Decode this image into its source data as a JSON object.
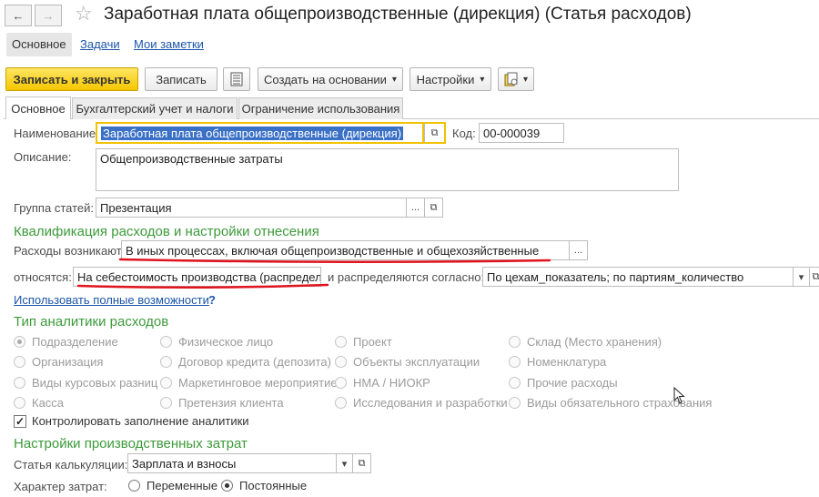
{
  "window": {
    "title": "Заработная плата общепроизводственные (дирекция) (Статья расходов)",
    "back_icon": "←",
    "forward_icon": "→",
    "star_icon": "☆"
  },
  "section_tabs": [
    "Основное",
    "Задачи",
    "Мои заметки"
  ],
  "toolbar": {
    "save_close": "Записать и закрыть",
    "save": "Записать",
    "create_based": "Создать на основании",
    "settings": "Настройки",
    "dropdown_glyph": "▾"
  },
  "tabs": [
    "Основное",
    "Бухгалтерский учет и налоги",
    "Ограничение использования"
  ],
  "form": {
    "name_label": "Наименование:",
    "name_value": "Заработная плата общепроизводственные (дирекция)",
    "code_label": "Код:",
    "code_value": "00-000039",
    "desc_label": "Описание:",
    "desc_value": "Общепроизводственные затраты",
    "group_label": "Группа статей:",
    "group_value": "Презентация",
    "ellipsis": "...",
    "open_glyph": "⧉"
  },
  "qualification": {
    "heading": "Квалификация расходов и настройки отнесения",
    "arise_label": "Расходы возникают:",
    "arise_value": "В иных процессах, включая общепроизводственные и общехозяйственные",
    "relate_label": "относятся:",
    "relate_value": "На себестоимость производства (распределя",
    "distribute_label": "и распределяются согласно:",
    "distribute_value": "По цехам_показатель; по партиям_количество",
    "full_link": "Использовать полные возможности",
    "help": "?"
  },
  "analytics": {
    "heading": "Тип аналитики расходов",
    "columns": [
      [
        "Подразделение",
        "Организация",
        "Виды курсовых разниц",
        "Касса"
      ],
      [
        "Физическое лицо",
        "Договор кредита (депозита)",
        "Маркетинговое мероприятие",
        "Претензия клиента"
      ],
      [
        "Проект",
        "Объекты эксплуатации",
        "НМА / НИОКР",
        "Исследования и разработки"
      ],
      [
        "Склад (Место хранения)",
        "Номенклатура",
        "Прочие расходы",
        "Виды обязательного страхования"
      ]
    ],
    "selected": "Подразделение",
    "control_check": "Контролировать заполнение аналитики",
    "check_glyph": "✓"
  },
  "production": {
    "heading": "Настройки производственных затрат",
    "calc_label": "Статья калькуляции:",
    "calc_value": "Зарплата и взносы",
    "nature_label": "Характер затрат:",
    "nature_options": [
      "Переменные",
      "Постоянные"
    ],
    "nature_selected": "Постоянные"
  },
  "colors": {
    "accent_green": "#3c9a3a",
    "link_blue": "#1b55a8",
    "primary_yellow": "#f5c600",
    "underline_red": "#e0141e"
  }
}
